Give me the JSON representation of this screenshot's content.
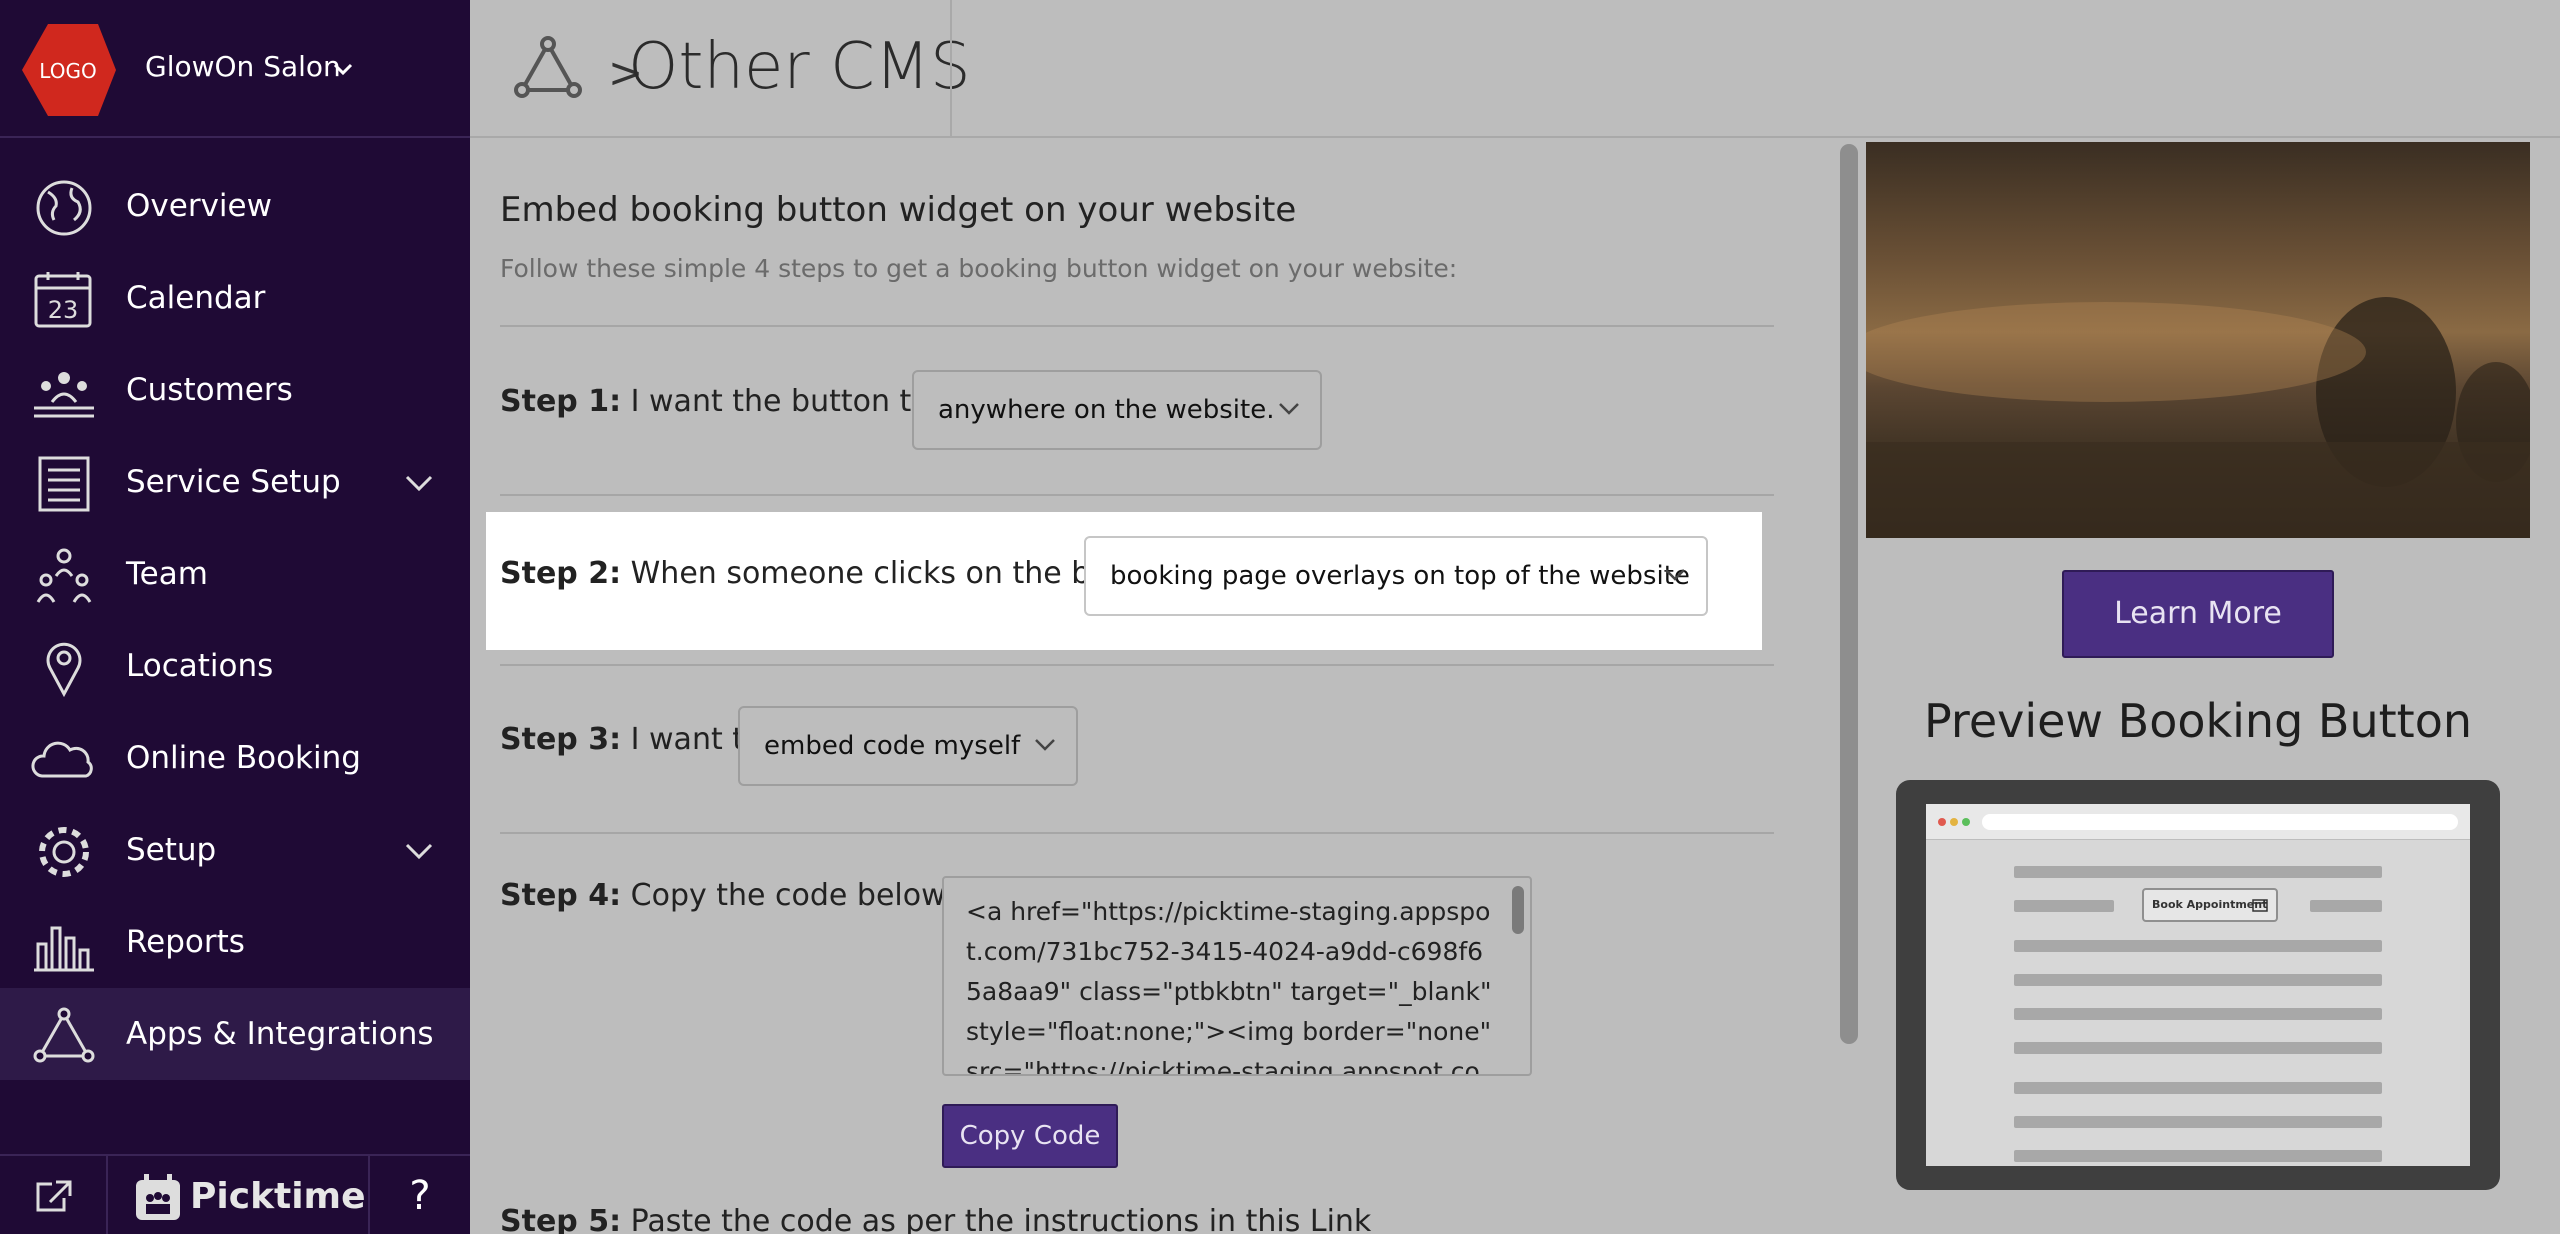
{
  "brand": {
    "logo_text": "LOGO",
    "name": "GlowOn Salon"
  },
  "sidebar": {
    "items": [
      {
        "label": "Overview",
        "icon": "globe-icon"
      },
      {
        "label": "Calendar",
        "icon": "calendar-icon",
        "icon_text": "23"
      },
      {
        "label": "Customers",
        "icon": "customers-icon"
      },
      {
        "label": "Service Setup",
        "icon": "list-icon",
        "has_submenu": true
      },
      {
        "label": "Team",
        "icon": "team-icon"
      },
      {
        "label": "Locations",
        "icon": "location-pin-icon"
      },
      {
        "label": "Online Booking",
        "icon": "cloud-icon"
      },
      {
        "label": "Setup",
        "icon": "gear-icon",
        "has_submenu": true
      },
      {
        "label": "Reports",
        "icon": "bar-chart-icon"
      },
      {
        "label": "Apps & Integrations",
        "icon": "integrations-icon",
        "active": true
      }
    ],
    "bottom": {
      "product_name": "Picktime",
      "help": "?"
    }
  },
  "header": {
    "separator": ">",
    "title": "Other CMS"
  },
  "content": {
    "title": "Embed booking button widget on your website",
    "subtitle": "Follow these simple 4 steps to get a booking button widget on your website:",
    "step1": {
      "label": "Step 1:",
      "text": "I want the button to be",
      "selected": "anywhere on the website."
    },
    "step2": {
      "label": "Step 2:",
      "text": "When someone clicks on the button",
      "selected": "booking page overlays on top of the website"
    },
    "step3": {
      "label": "Step 3:",
      "text": "I want to :",
      "selected": "embed code myself"
    },
    "step4": {
      "label": "Step 4:",
      "text": "Copy the code below",
      "code": "<a href=\"https://picktime-staging.appspot.com/731bc752-3415-4024-a9dd-c698f65a8aa9\" class=\"ptbkbtn\" target=\"_blank\" style=\"float:none;\"><img border=\"none\" src=\"https://picktime-staging.appspot.com/booki",
      "copy_button": "Copy Code"
    },
    "step5": {
      "label": "Step 5:",
      "text": "Paste the code as per the instructions in this Link"
    }
  },
  "preview": {
    "learn_more": "Learn More",
    "title": "Preview Booking Button",
    "mock_button": "Book Appointment"
  },
  "colors": {
    "sidebar_bg": "#1f0a35",
    "accent_purple": "#4a2f82",
    "logo_red": "#d0281e"
  }
}
